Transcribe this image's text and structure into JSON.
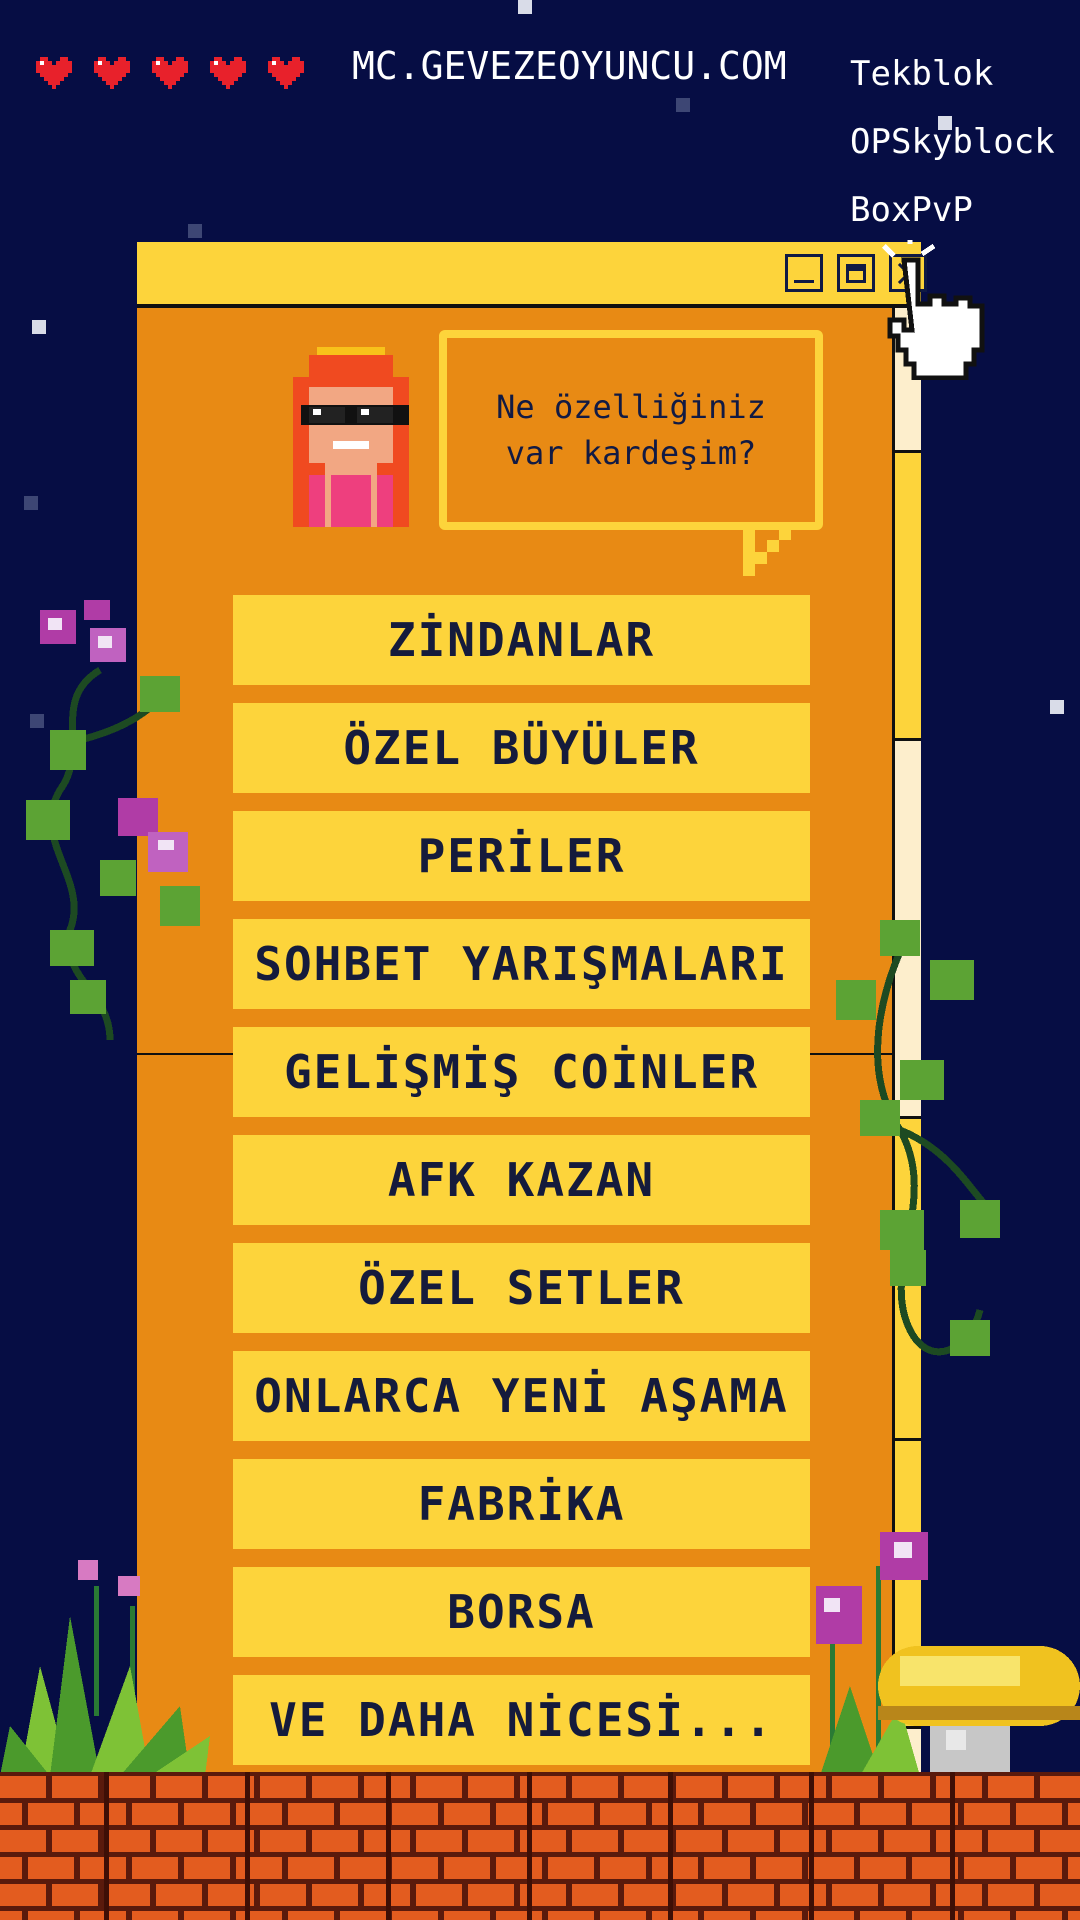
{
  "hearts": {
    "count": 5,
    "color": "#e8212b"
  },
  "site_url": "MC.GEVEZEOYUNCU.COM",
  "servers": [
    "Tekblok",
    "OPSkyblock",
    "BoxPvP"
  ],
  "window": {
    "controls": [
      "minimize-icon",
      "maximize-icon",
      "close-icon"
    ],
    "speech_bubble": "Ne özelliğiniz\nvar kardeşim?",
    "menu_items": [
      "ZİNDANLAR",
      "ÖZEL BÜYÜLER",
      "PERİLER",
      "SOHBET YARIŞMALARI",
      "GELİŞMİŞ COİNLER",
      "AFK KAZAN",
      "ÖZEL SETLER",
      "ONLARCA YENİ AŞAMA",
      "FABRİKA",
      "BORSA",
      "VE DAHA NİCESİ..."
    ]
  },
  "colors": {
    "background": "#060d44",
    "window_body": "#e88a14",
    "accent_yellow": "#fdd43b",
    "text_dark": "#151b3c",
    "brick": "#e35c1f"
  }
}
